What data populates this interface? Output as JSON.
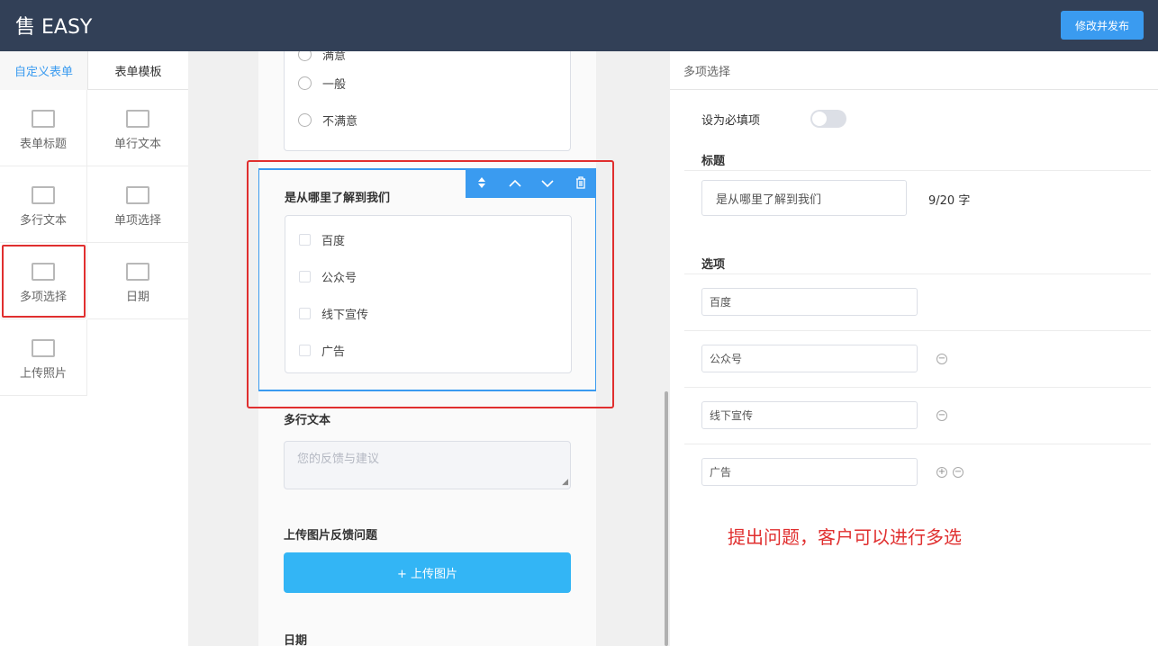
{
  "header": {
    "brand": "售 EASY",
    "publish_label": "修改并发布"
  },
  "left_panel": {
    "tabs": [
      "自定义表单",
      "表单模板"
    ],
    "widgets": [
      "表单标题",
      "单行文本",
      "多行文本",
      "单项选择",
      "多项选择",
      "日期",
      "上传照片"
    ]
  },
  "canvas": {
    "prev_radio_options": [
      "满意",
      "一般",
      "不满意"
    ],
    "selected_question": {
      "title": "是从哪里了解到我们",
      "options": [
        "百度",
        "公众号",
        "线下宣传",
        "广告"
      ]
    },
    "toolbar_icons": [
      "sort-icon",
      "arrow-up-icon",
      "arrow-down-icon",
      "trash-icon"
    ],
    "multiline": {
      "title": "多行文本",
      "placeholder": "您的反馈与建议"
    },
    "upload": {
      "title": "上传图片反馈问题",
      "button_label": "+ 上传图片"
    },
    "date": {
      "title": "日期"
    }
  },
  "right_panel": {
    "header": "多项选择",
    "required_label": "设为必填项",
    "required_on": false,
    "title_label": "标题",
    "title_value": "是从哪里了解到我们",
    "char_count": "9/20 字",
    "options_label": "选项",
    "options": [
      "百度",
      "公众号",
      "线下宣传",
      "广告"
    ],
    "annotation": "提出问题，客户可以进行多选"
  },
  "colors": {
    "header_bg": "#324057",
    "accent": "#3a9bf0",
    "highlight": "#e02f2f",
    "upload": "#33b5f5"
  }
}
